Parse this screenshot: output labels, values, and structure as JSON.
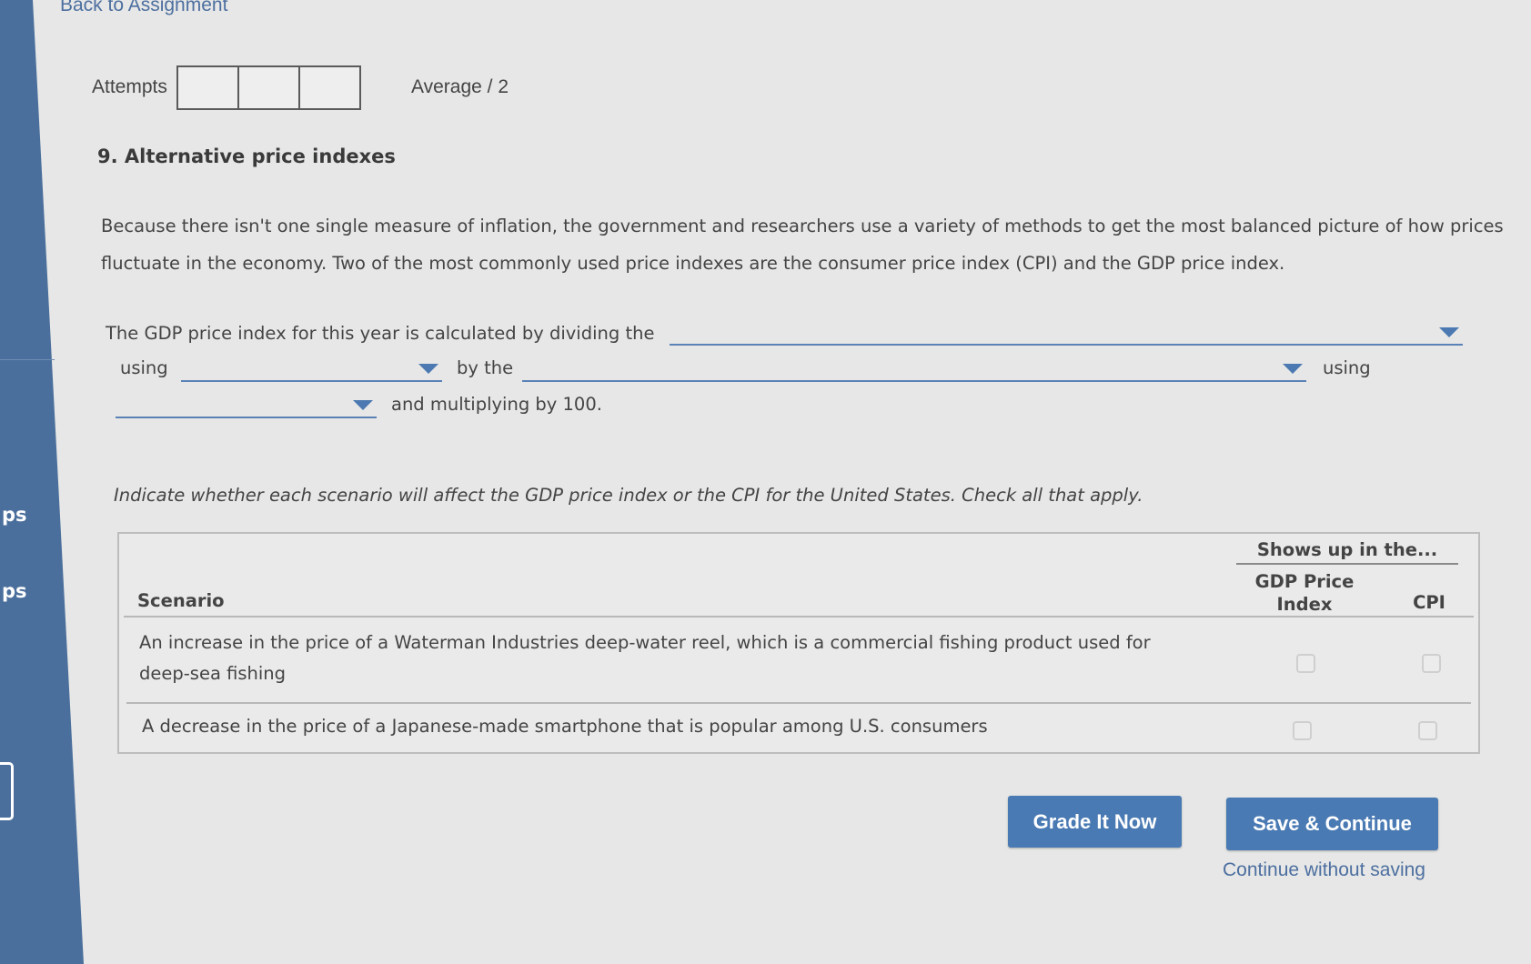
{
  "nav": {
    "back_link": "Back to Assignment"
  },
  "sidebar": {
    "frag1": "ps",
    "frag2": "ps"
  },
  "header": {
    "attempts_label": "Attempts",
    "average_label": "Average / 2"
  },
  "question": {
    "title": "9. Alternative price indexes",
    "intro": "Because there isn't one single measure of inflation, the government and researchers use a variety of methods to get the most balanced picture of how prices fluctuate in the economy. Two of the most commonly used price indexes are the consumer price index (CPI) and the GDP price index.",
    "sentence": {
      "part1": "The GDP price index for this year is calculated by dividing the",
      "part2": "using",
      "part3": "by the",
      "part4": "using",
      "part5": "and multiplying by 100."
    },
    "dropdowns": [
      {
        "selected": ""
      },
      {
        "selected": ""
      },
      {
        "selected": ""
      },
      {
        "selected": ""
      }
    ],
    "instruction": "Indicate whether each scenario will affect the GDP price index or the CPI for the United States. Check all that apply."
  },
  "table": {
    "group_header": "Shows up in the...",
    "col_scenario": "Scenario",
    "col_gdp": "GDP Price Index",
    "col_cpi": "CPI",
    "rows": [
      {
        "scenario": "An increase in the price of a Waterman Industries deep-water reel, which is a commercial fishing product used for deep-sea fishing",
        "gdp_checked": false,
        "cpi_checked": false
      },
      {
        "scenario": "A decrease in the price of a Japanese-made smartphone that is popular among U.S. consumers",
        "gdp_checked": false,
        "cpi_checked": false
      }
    ]
  },
  "actions": {
    "grade_label": "Grade It Now",
    "save_label": "Save & Continue",
    "continue_label": "Continue without saving"
  },
  "colors": {
    "sidebar": "#4b6f9c",
    "button": "#4a7ab3",
    "link": "#4d6fa0",
    "dropdown_line": "#5b82b6"
  }
}
